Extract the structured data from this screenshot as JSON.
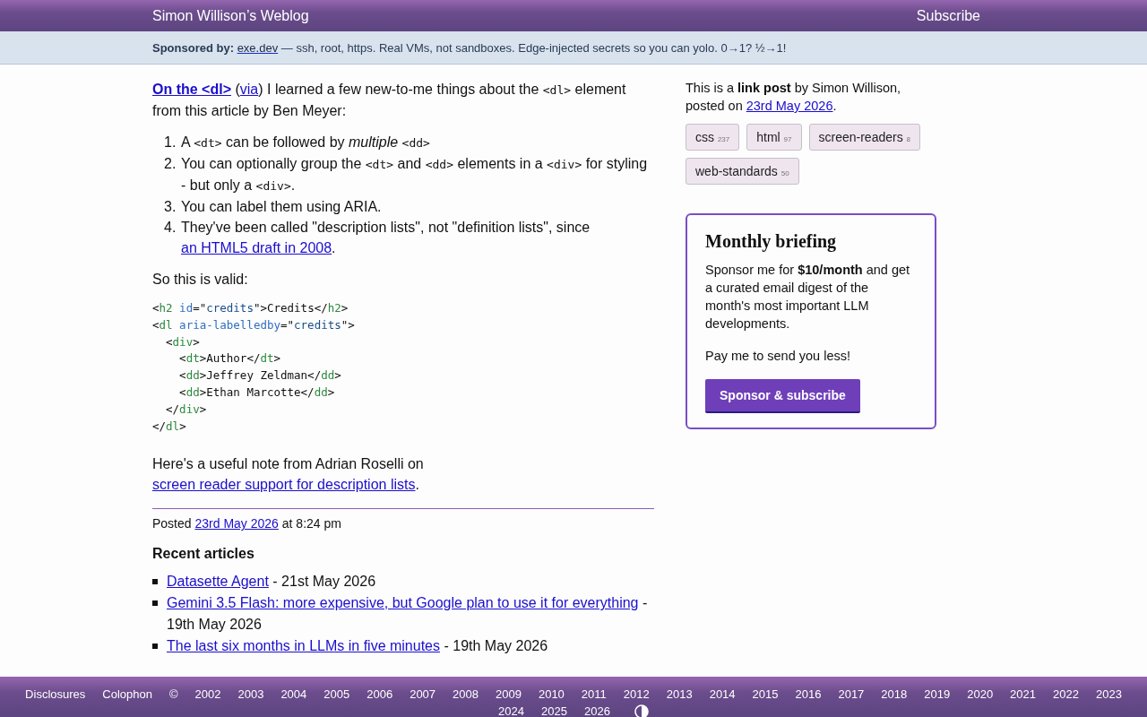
{
  "header": {
    "title": "Simon Willison’s Weblog",
    "subscribe": "Subscribe"
  },
  "sponsor_bar": {
    "label": "Sponsored by:",
    "link": "exe.dev",
    "text": " — ssh, root, https. Real VMs, not sandboxes. Edge-injected secrets so you can yolo. 0→1? ½→1!"
  },
  "intro": [
    {
      "kind": "strong_link",
      "text": "On the <dl>"
    },
    {
      "kind": "text",
      "text": " ("
    },
    {
      "kind": "link",
      "text": "via"
    },
    {
      "kind": "text",
      "text": ") I learned a few new-to-me things about the "
    },
    {
      "kind": "code",
      "text": "<dl>"
    },
    {
      "kind": "text",
      "text": " element from this article by Ben Meyer:"
    }
  ],
  "list": [
    {
      "number": "1.",
      "segments": [
        {
          "kind": "text",
          "text": "A "
        },
        {
          "kind": "code",
          "text": "<dt>"
        },
        {
          "kind": "text",
          "text": " can be followed by "
        },
        {
          "kind": "em",
          "text": "multiple"
        },
        {
          "kind": "space"
        },
        {
          "kind": "code",
          "text": "<dd>"
        }
      ]
    },
    {
      "number": "2.",
      "segments": [
        {
          "kind": "text",
          "text": "You can optionally group the "
        },
        {
          "kind": "code",
          "text": "<dt>"
        },
        {
          "kind": "text",
          "text": " and "
        },
        {
          "kind": "code",
          "text": "<dd>"
        },
        {
          "kind": "text",
          "text": " elements in a "
        },
        {
          "kind": "code",
          "text": "<div>"
        },
        {
          "kind": "text",
          "text": " for styling - but only a "
        },
        {
          "kind": "code",
          "text": "<div>"
        },
        {
          "kind": "text",
          "text": "."
        }
      ]
    },
    {
      "number": "3.",
      "segments": [
        {
          "kind": "text",
          "text": "You can label them using ARIA."
        }
      ]
    },
    {
      "number": "4.",
      "segments": [
        {
          "kind": "text",
          "text": "They've been called \"description lists\", not \"definition lists\", since "
        },
        {
          "kind": "link",
          "text": "an HTML5 draft in 2008"
        },
        {
          "kind": "text",
          "text": "."
        }
      ]
    }
  ],
  "valid_text": "So this is valid:",
  "code_lines": [
    [
      {
        "kind": "punct",
        "text": "<"
      },
      {
        "kind": "tag",
        "text": "h2 "
      },
      {
        "kind": "attr",
        "text": "id"
      },
      {
        "kind": "punct",
        "text": "=\""
      },
      {
        "kind": "value",
        "text": "credits"
      },
      {
        "kind": "punct",
        "text": "\">Credits</"
      },
      {
        "kind": "tag",
        "text": "h2"
      },
      {
        "kind": "punct",
        "text": ">"
      }
    ],
    [
      {
        "kind": "punct",
        "text": "<"
      },
      {
        "kind": "tag",
        "text": "dl "
      },
      {
        "kind": "attr",
        "text": "aria-labelledby"
      },
      {
        "kind": "punct",
        "text": "=\""
      },
      {
        "kind": "value",
        "text": "credits"
      },
      {
        "kind": "punct",
        "text": "\">"
      }
    ],
    [
      {
        "kind": "punct",
        "text": "  <"
      },
      {
        "kind": "tag",
        "text": "div"
      },
      {
        "kind": "punct",
        "text": ">"
      }
    ],
    [
      {
        "kind": "punct",
        "text": "    <"
      },
      {
        "kind": "tag",
        "text": "dt"
      },
      {
        "kind": "punct",
        "text": ">Author</"
      },
      {
        "kind": "tag",
        "text": "dt"
      },
      {
        "kind": "punct",
        "text": ">"
      }
    ],
    [
      {
        "kind": "punct",
        "text": "    <"
      },
      {
        "kind": "tag",
        "text": "dd"
      },
      {
        "kind": "punct",
        "text": ">Jeffrey Zeldman</"
      },
      {
        "kind": "tag",
        "text": "dd"
      },
      {
        "kind": "punct",
        "text": ">"
      }
    ],
    [
      {
        "kind": "punct",
        "text": "    <"
      },
      {
        "kind": "tag",
        "text": "dd"
      },
      {
        "kind": "punct",
        "text": ">Ethan Marcotte</"
      },
      {
        "kind": "tag",
        "text": "dd"
      },
      {
        "kind": "punct",
        "text": ">"
      }
    ],
    [
      {
        "kind": "punct",
        "text": "  </"
      },
      {
        "kind": "tag",
        "text": "div"
      },
      {
        "kind": "punct",
        "text": ">"
      }
    ],
    [
      {
        "kind": "punct",
        "text": "</"
      },
      {
        "kind": "tag",
        "text": "dl"
      },
      {
        "kind": "punct",
        "text": ">"
      }
    ]
  ],
  "note": [
    {
      "kind": "text",
      "text": "Here's a useful note from Adrian Roselli on "
    },
    {
      "kind": "link",
      "text": "screen reader support for description lists"
    },
    {
      "kind": "text",
      "text": "."
    }
  ],
  "posted": [
    {
      "kind": "text",
      "text": "Posted "
    },
    {
      "kind": "link",
      "text": "23rd May 2026"
    },
    {
      "kind": "text",
      "text": " at 8:24 pm"
    }
  ],
  "recent": {
    "title": "Recent articles",
    "items": [
      {
        "link": "Datasette Agent",
        "date": " - 21st May 2026"
      },
      {
        "link": "Gemini 3.5 Flash: more expensive, but Google plan to use it for everything",
        "date": " - 19th May 2026"
      },
      {
        "link": "The last six months in LLMs in five minutes",
        "date": " - 19th May 2026"
      }
    ]
  },
  "sidebar": {
    "about": [
      {
        "kind": "text",
        "text": "This is a "
      },
      {
        "kind": "strong",
        "text": "link post"
      },
      {
        "kind": "text",
        "text": " by Simon Willison, posted on "
      },
      {
        "kind": "link",
        "text": "23rd May 2026"
      },
      {
        "kind": "text",
        "text": "."
      }
    ],
    "tags": [
      {
        "name": "css",
        "count": "237"
      },
      {
        "name": "html",
        "count": "97"
      },
      {
        "name": "screen-readers",
        "count": "8"
      },
      {
        "name": "web-standards",
        "count": "50"
      }
    ],
    "briefing": {
      "title": "Monthly briefing",
      "body": [
        {
          "kind": "text",
          "text": "Sponsor me for "
        },
        {
          "kind": "strong",
          "text": "$10/month"
        },
        {
          "kind": "text",
          "text": " and get a curated email digest of the month's most important LLM developments."
        }
      ],
      "tagline": "Pay me to send you less!",
      "button": "Sponsor & subscribe"
    }
  },
  "footer": {
    "links": [
      "Disclosures",
      "Colophon"
    ],
    "copyright": "©",
    "years": [
      "2002",
      "2003",
      "2004",
      "2005",
      "2006",
      "2007",
      "2008",
      "2009",
      "2010",
      "2011",
      "2012",
      "2013",
      "2014",
      "2015",
      "2016",
      "2017",
      "2018",
      "2019",
      "2020",
      "2021",
      "2022",
      "2023",
      "2024",
      "2025",
      "2026"
    ]
  }
}
